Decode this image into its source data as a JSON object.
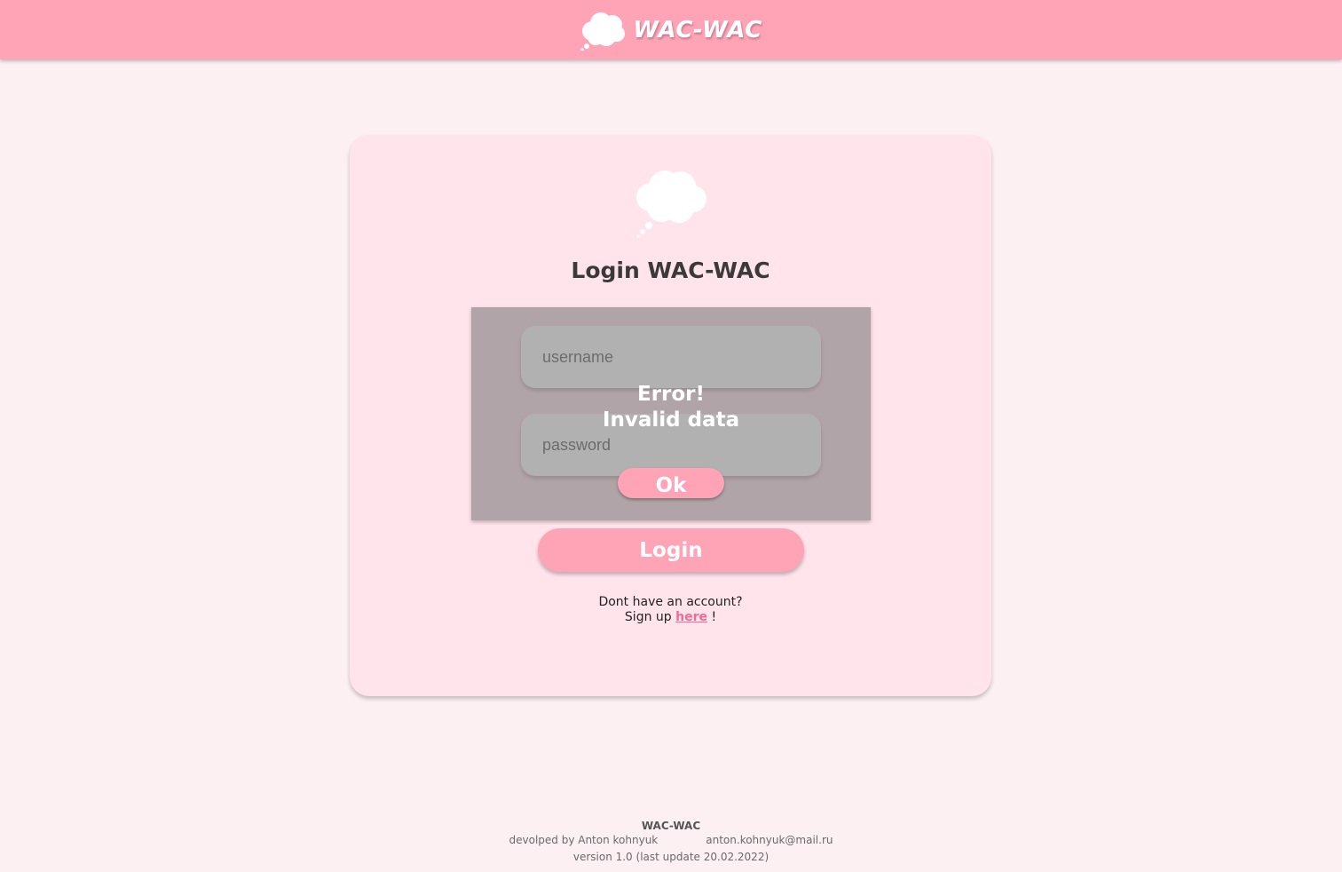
{
  "header": {
    "title": "WAC-WAC"
  },
  "card": {
    "title": "Login WAC-WAC",
    "username_placeholder": "username",
    "password_placeholder": "password",
    "error_title": "Error!",
    "error_message": "Invalid data",
    "ok_label": "Ok",
    "login_label": "Login",
    "signup_question": "Dont have an account?",
    "signup_prefix": "Sign up",
    "signup_link": "here",
    "signup_suffix": "!"
  },
  "footer": {
    "title": "WAC-WAC",
    "developer": "devolped by Anton kohnyuk",
    "email": "anton.kohnyuk@mail.ru",
    "version": "version 1.0 (last update 20.02.2022)"
  },
  "colors": {
    "accent": "#ffa3b7",
    "background": "#fcf0f3",
    "card": "#ffe4ec",
    "link": "#f06b95"
  },
  "icons": [
    "cloud-logo-icon",
    "cloud-icon"
  ]
}
